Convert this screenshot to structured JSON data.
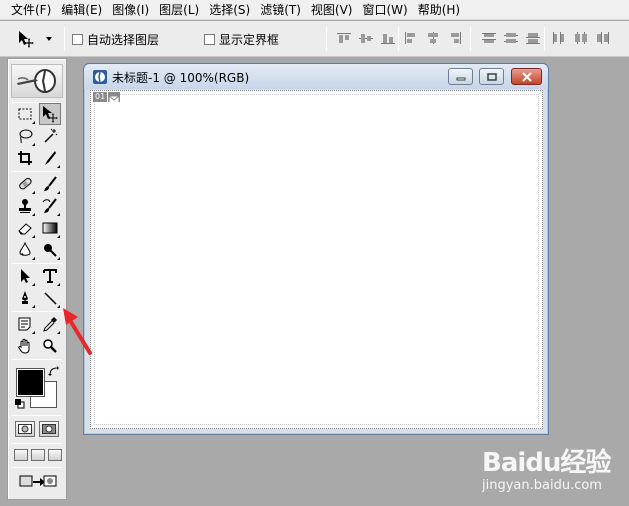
{
  "menubar": {
    "items": [
      "文件(F)",
      "编辑(E)",
      "图像(I)",
      "图层(L)",
      "选择(S)",
      "滤镜(T)",
      "视图(V)",
      "窗口(W)",
      "帮助(H)"
    ]
  },
  "options": {
    "tool_icon": "move-tool-icon",
    "auto_select_label": "自动选择图层",
    "auto_select_checked": false,
    "show_bounds_label": "显示定界框",
    "show_bounds_checked": false
  },
  "toolbox": {
    "tools": [
      "rectangular-marquee",
      "move",
      "lasso",
      "magic-wand",
      "crop",
      "slice",
      "healing-brush",
      "brush",
      "clone-stamp",
      "history-brush",
      "eraser",
      "gradient",
      "blur",
      "dodge",
      "path-selection",
      "type",
      "pen",
      "line",
      "notes",
      "eyedropper",
      "hand",
      "zoom"
    ],
    "active_tool": "move",
    "foreground_color": "#000000",
    "background_color": "#ffffff"
  },
  "document": {
    "title": "未标题-1 @ 100%(RGB)",
    "slice_number": "01"
  },
  "annotation": {
    "arrow_color": "#e8262b"
  },
  "watermark": {
    "brand": "Baidu经验",
    "url": "jingyan.baidu.com"
  }
}
